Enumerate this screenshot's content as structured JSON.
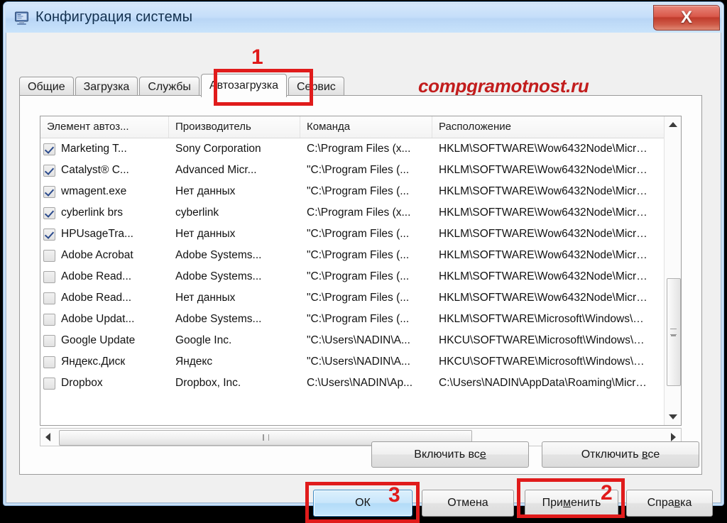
{
  "window": {
    "title": "Конфигурация системы",
    "icon": "system-configuration-icon",
    "close_label": "X",
    "accent_red": "#c21d1d",
    "titlebar_blue": "#bcd8f3"
  },
  "watermark": {
    "text": "compgramotnost.ru"
  },
  "tabs": [
    {
      "label": "Общие",
      "active": false
    },
    {
      "label": "Загрузка",
      "active": false
    },
    {
      "label": "Службы",
      "active": false
    },
    {
      "label": "Автозагрузка",
      "active": true
    },
    {
      "label": "Сервис",
      "active": false
    }
  ],
  "list": {
    "columns": [
      "Элемент автоз...",
      "Производитель",
      "Команда",
      "Расположение"
    ],
    "rows": [
      {
        "checked": true,
        "item": "Marketing T...",
        "manufacturer": "Sony Corporation",
        "command": "C:\\Program Files (x...",
        "location": "HKLM\\SOFTWARE\\Wow6432Node\\Micr…"
      },
      {
        "checked": true,
        "item": "Catalyst® C...",
        "manufacturer": "Advanced Micr...",
        "command": "\"C:\\Program Files (...",
        "location": "HKLM\\SOFTWARE\\Wow6432Node\\Micr…"
      },
      {
        "checked": true,
        "item": "wmagent.exe",
        "manufacturer": "Нет данных",
        "command": "\"C:\\Program Files (...",
        "location": "HKLM\\SOFTWARE\\Wow6432Node\\Micr…"
      },
      {
        "checked": true,
        "item": "cyberlink brs",
        "manufacturer": "cyberlink",
        "command": "C:\\Program Files (x...",
        "location": "HKLM\\SOFTWARE\\Wow6432Node\\Micr…"
      },
      {
        "checked": true,
        "item": "HPUsageTra...",
        "manufacturer": "Нет данных",
        "command": "\"C:\\Program Files (...",
        "location": "HKLM\\SOFTWARE\\Wow6432Node\\Micr…"
      },
      {
        "checked": false,
        "item": "Adobe Acrobat",
        "manufacturer": "Adobe Systems...",
        "command": "\"C:\\Program Files (...",
        "location": "HKLM\\SOFTWARE\\Wow6432Node\\Micr…"
      },
      {
        "checked": false,
        "item": "Adobe Read...",
        "manufacturer": "Adobe Systems...",
        "command": "\"C:\\Program Files (...",
        "location": "HKLM\\SOFTWARE\\Wow6432Node\\Micr…"
      },
      {
        "checked": false,
        "item": "Adobe Read...",
        "manufacturer": "Нет данных",
        "command": "\"C:\\Program Files (...",
        "location": "HKLM\\SOFTWARE\\Wow6432Node\\Micr…"
      },
      {
        "checked": false,
        "item": "Adobe Updat...",
        "manufacturer": "Adobe Systems...",
        "command": "\"C:\\Program Files (...",
        "location": "HKLM\\SOFTWARE\\Microsoft\\Windows\\…"
      },
      {
        "checked": false,
        "item": "Google Update",
        "manufacturer": "Google Inc.",
        "command": "\"C:\\Users\\NADIN\\A...",
        "location": "HKCU\\SOFTWARE\\Microsoft\\Windows\\…"
      },
      {
        "checked": false,
        "item": "Яндекс.Диск",
        "manufacturer": "Яндекс",
        "command": "\"C:\\Users\\NADIN\\A...",
        "location": "HKCU\\SOFTWARE\\Microsoft\\Windows\\…"
      },
      {
        "checked": false,
        "item": "Dropbox",
        "manufacturer": "Dropbox, Inc.",
        "command": "C:\\Users\\NADIN\\Ap...",
        "location": "C:\\Users\\NADIN\\AppData\\Roaming\\Micr…"
      }
    ]
  },
  "toolbar": {
    "enable_all": "Включить все",
    "enable_all_pre": "Включить вс",
    "enable_all_acc": "е",
    "disable_all_pre": "Отключить ",
    "disable_all_acc": "в",
    "disable_all_post": "се"
  },
  "buttons": {
    "ok": "ОК",
    "cancel": "Отмена",
    "apply_pre": "При",
    "apply_acc": "м",
    "apply_post": "енить",
    "help_pre": "Спра",
    "help_acc": "в",
    "help_post": "ка"
  },
  "annotations": [
    {
      "number": "1",
      "target": "tab-autozagruzka"
    },
    {
      "number": "2",
      "target": "apply-button"
    },
    {
      "number": "3",
      "target": "ok-button"
    }
  ]
}
